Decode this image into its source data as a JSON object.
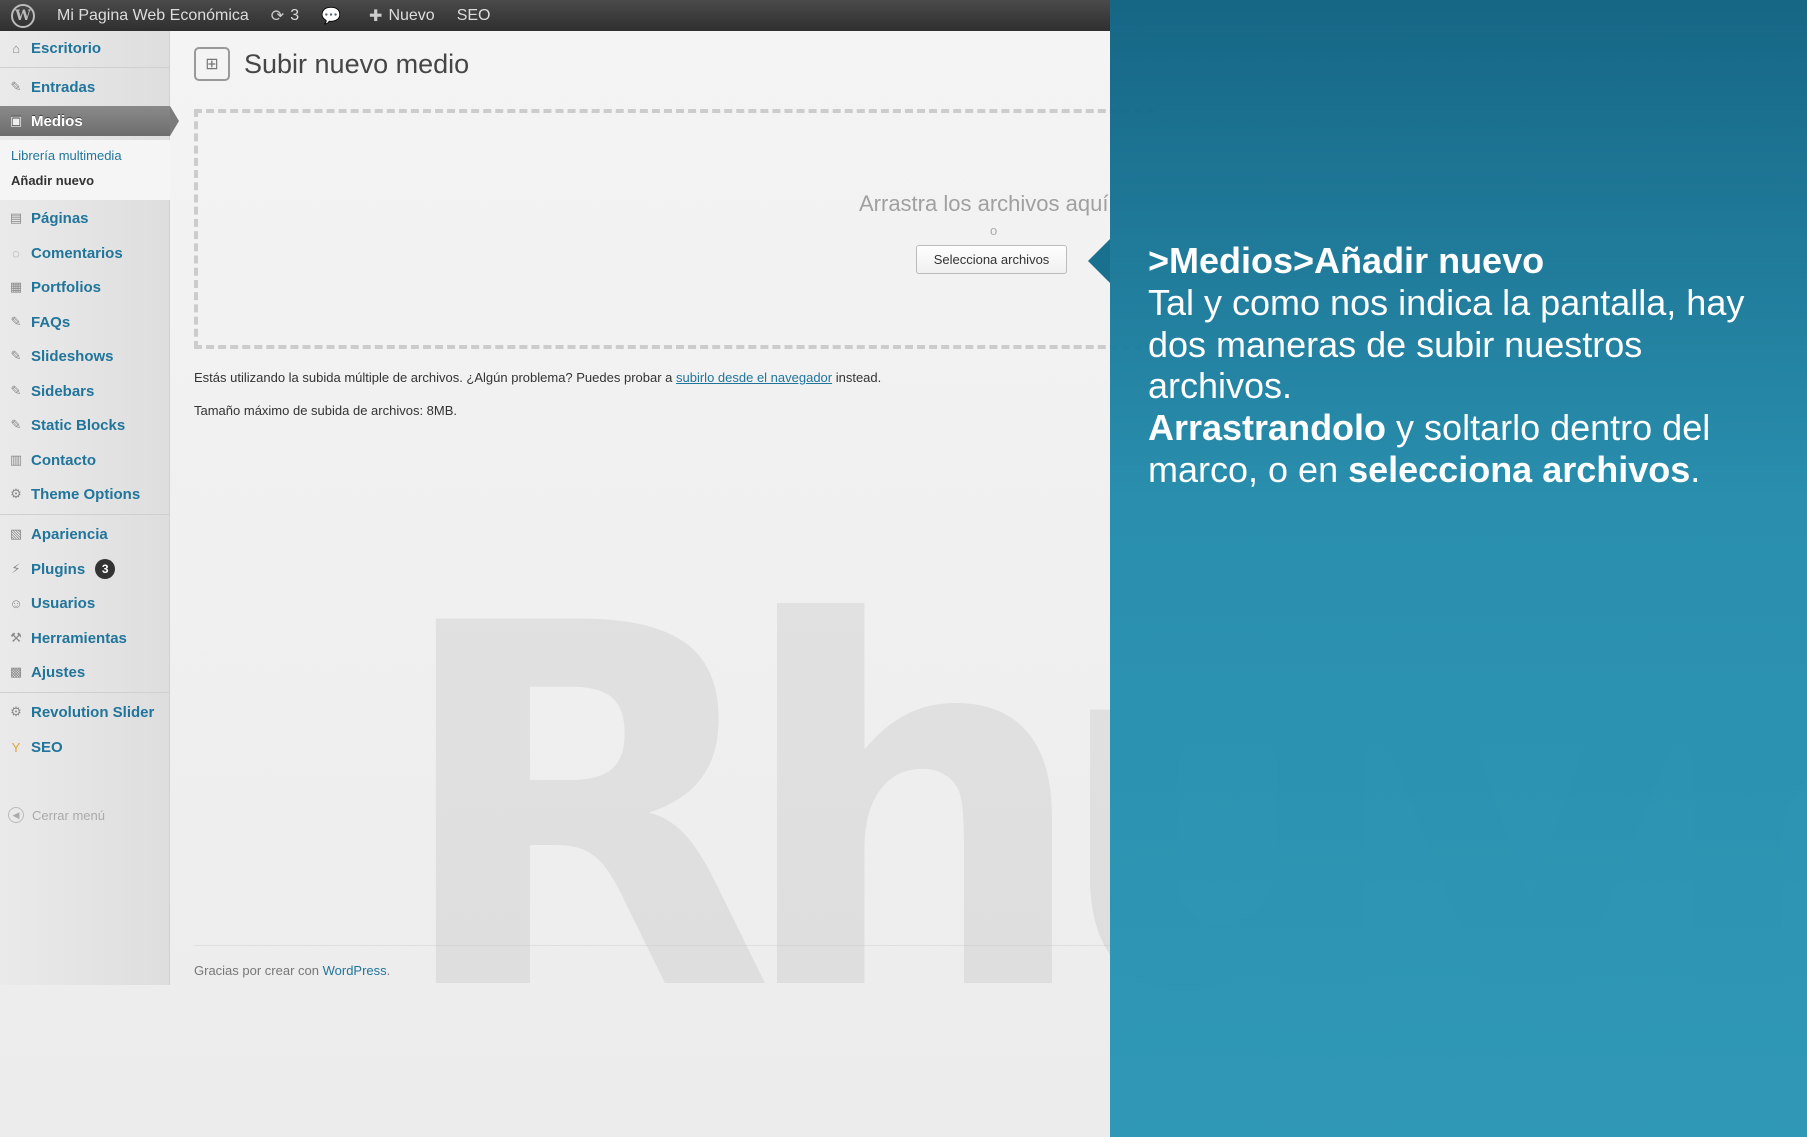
{
  "admin_bar": {
    "site_name": "Mi Pagina Web Económica",
    "updates_count": "3",
    "new_label": "Nuevo",
    "seo_label": "SEO",
    "icons": [
      "wordpress-logo-icon",
      "refresh-icon",
      "comment-icon",
      "plus-icon"
    ]
  },
  "sidebar": {
    "items": [
      {
        "label": "Escritorio",
        "icon": "dashboard-icon"
      },
      {
        "label": "Entradas",
        "icon": "pin-icon"
      },
      {
        "label": "Medios",
        "icon": "media-icon"
      },
      {
        "label": "Páginas",
        "icon": "pages-icon"
      },
      {
        "label": "Comentarios",
        "icon": "comments-icon"
      },
      {
        "label": "Portfolios",
        "icon": "portfolio-icon"
      },
      {
        "label": "FAQs",
        "icon": "pin-icon"
      },
      {
        "label": "Slideshows",
        "icon": "pin-icon"
      },
      {
        "label": "Sidebars",
        "icon": "pin-icon"
      },
      {
        "label": "Static Blocks",
        "icon": "pin-icon"
      },
      {
        "label": "Contacto",
        "icon": "contact-icon"
      },
      {
        "label": "Theme Options",
        "icon": "gear-icon"
      },
      {
        "label": "Apariencia",
        "icon": "appearance-icon"
      },
      {
        "label": "Plugins",
        "icon": "plugin-icon",
        "badge": "3"
      },
      {
        "label": "Usuarios",
        "icon": "users-icon"
      },
      {
        "label": "Herramientas",
        "icon": "tools-icon"
      },
      {
        "label": "Ajustes",
        "icon": "settings-icon"
      },
      {
        "label": "Revolution Slider",
        "icon": "gear-icon"
      },
      {
        "label": "SEO",
        "icon": "seo-icon"
      }
    ],
    "submenu": [
      {
        "label": "Librería multimedia"
      },
      {
        "label": "Añadir nuevo"
      }
    ],
    "collapse_label": "Cerrar menú"
  },
  "main": {
    "title": "Subir nuevo medio",
    "drop_text": "Arrastra los archivos aquí",
    "or_text": "o",
    "select_button": "Selecciona archivos",
    "info_prefix": "Estás utilizando la subida múltiple de archivos. ¿Algún problema? Puedes probar a ",
    "info_link": "subirlo desde el navegador",
    "info_suffix": " instead.",
    "max_size": "Tamaño máximo de subida de archivos: 8MB.",
    "footer_prefix": "Gracias por crear con ",
    "footer_link": "WordPress",
    "footer_suffix": "."
  },
  "watermark": "Rhuvn",
  "overlay": {
    "title": ">Medios>Añadir nuevo",
    "line1": "Tal y como nos indica la pantalla, hay dos maneras de subir nuestros archivos.",
    "bold1": "Arrastrandolo",
    "mid": " y soltarlo dentro del marco, o en ",
    "bold2": "selecciona archivos",
    "end": "."
  },
  "colors": {
    "admin_bar": "#3a3a3a",
    "link": "#21759b",
    "overlay": "#1f8aac",
    "active_menu": "#7b7b7b"
  }
}
